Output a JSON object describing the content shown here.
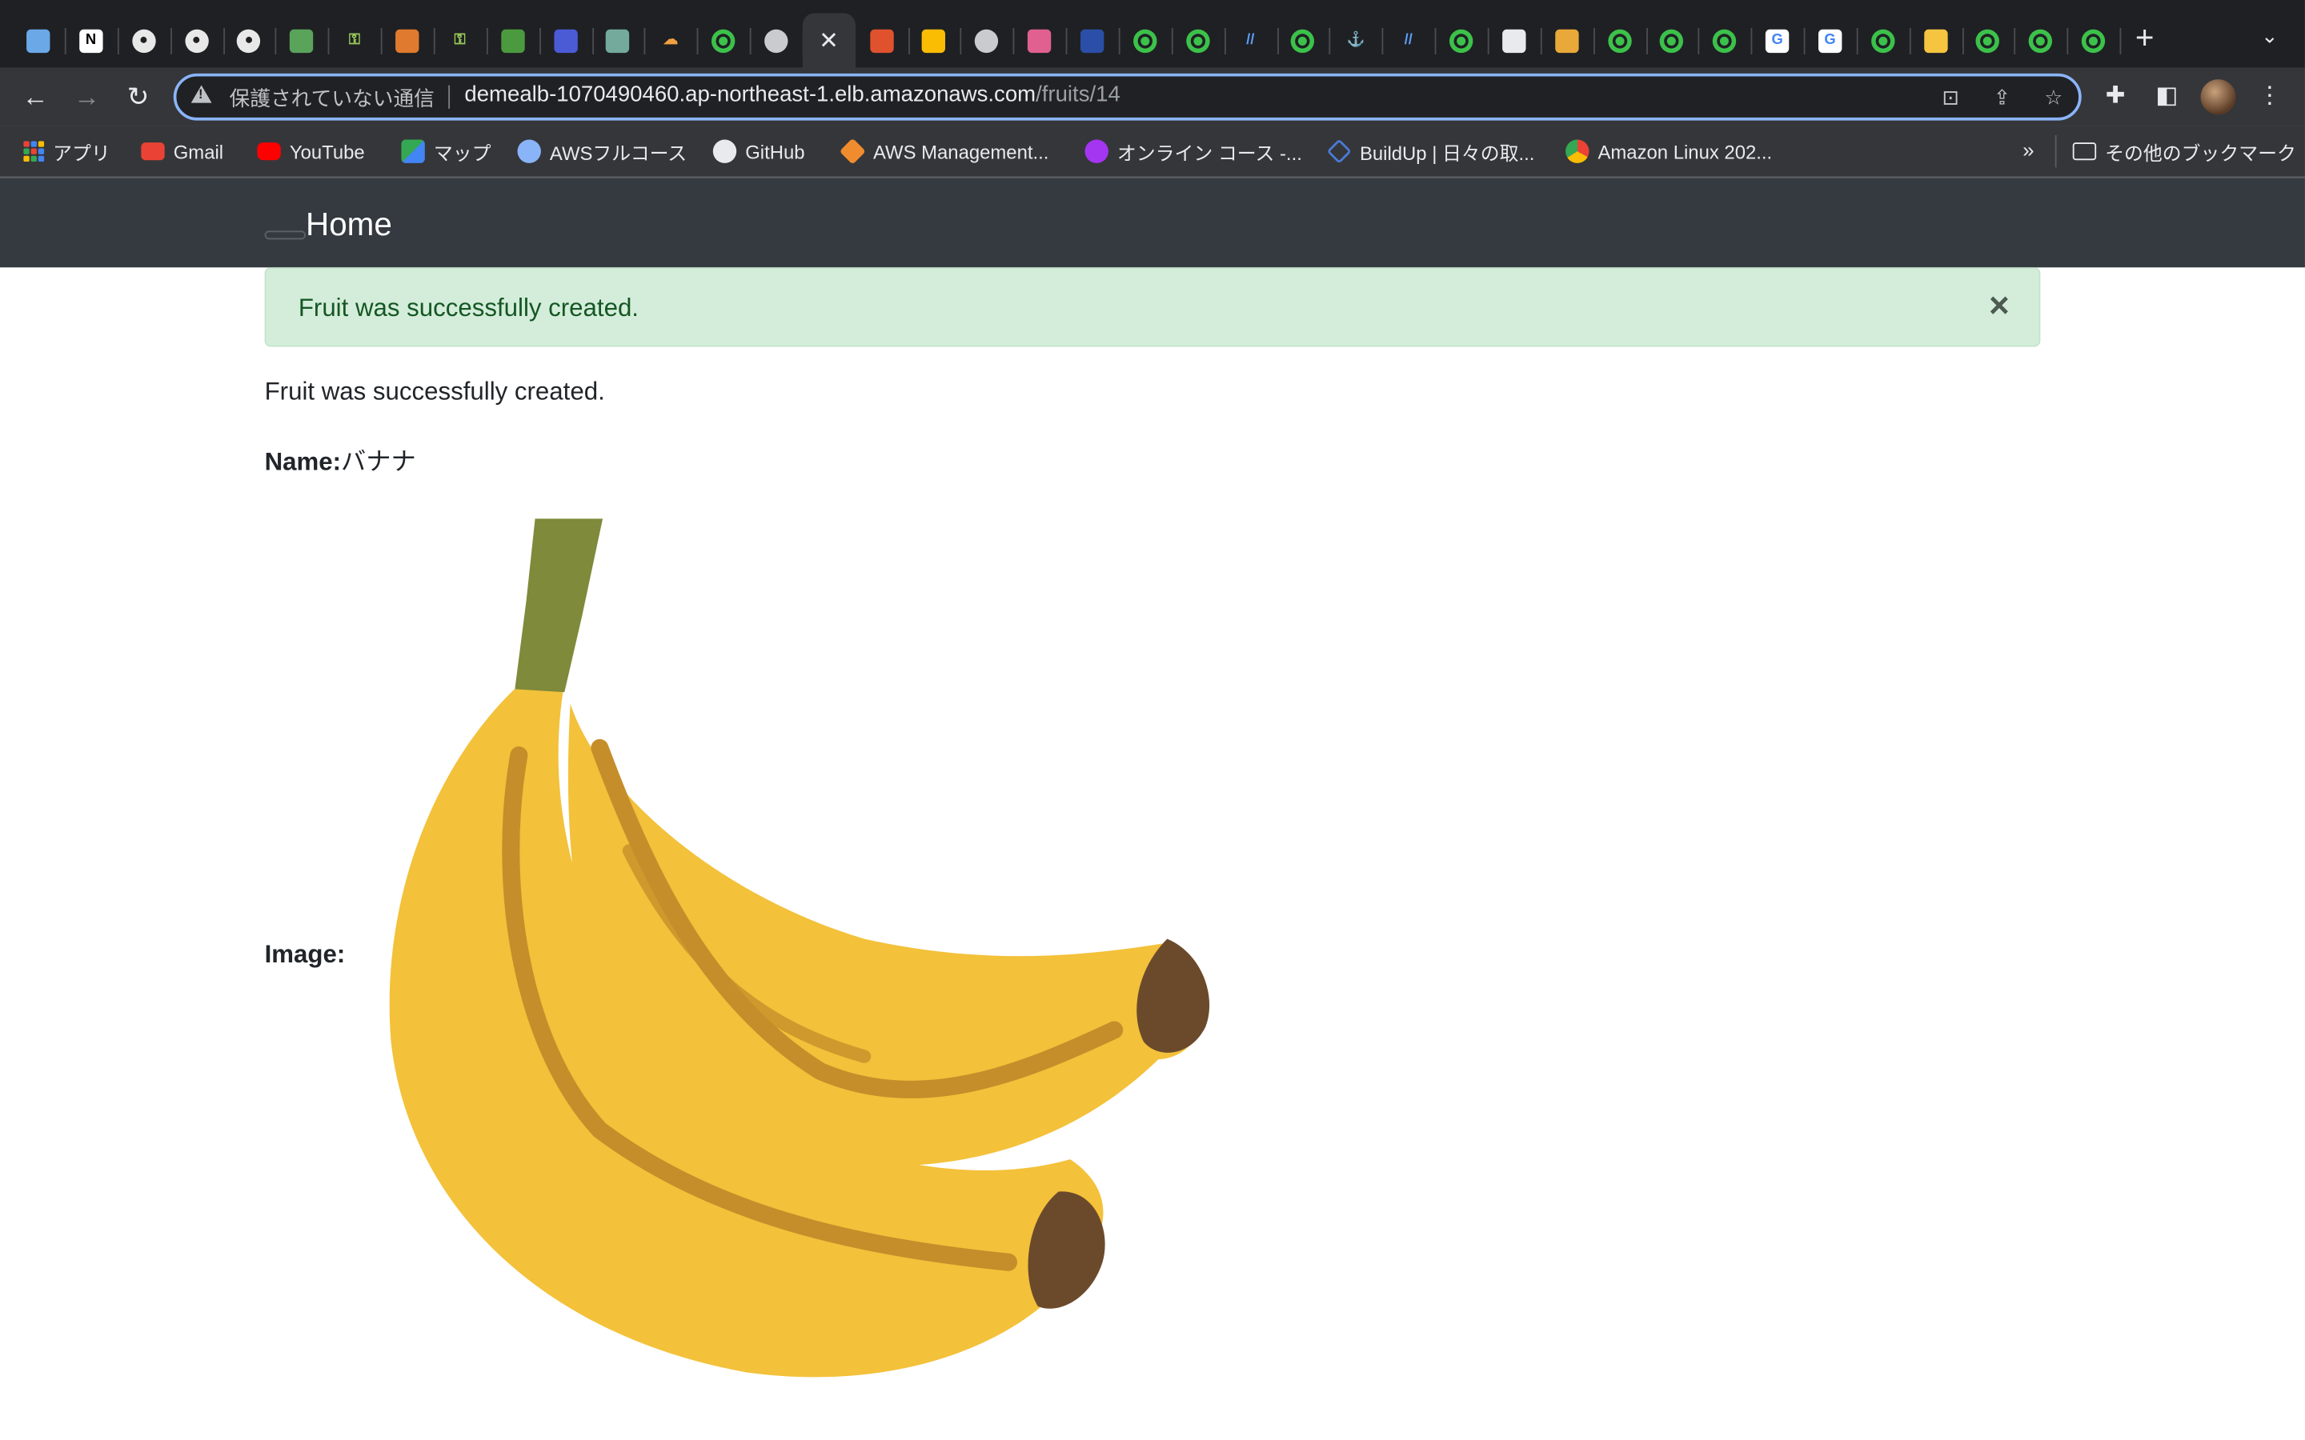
{
  "browser": {
    "tabs": [
      {
        "icon": "colorful-figure-icon"
      },
      {
        "icon": "notion-icon"
      },
      {
        "icon": "github-icon"
      },
      {
        "icon": "github-icon"
      },
      {
        "icon": "github-icon"
      },
      {
        "icon": "green-app-icon"
      },
      {
        "icon": "key-icon"
      },
      {
        "icon": "orange-app-icon"
      },
      {
        "icon": "key-icon"
      },
      {
        "icon": "green-square-icon"
      },
      {
        "icon": "blue-grid-icon"
      },
      {
        "icon": "chatgpt-icon"
      },
      {
        "icon": "cloud-outline-icon"
      },
      {
        "icon": "green-ring-icon"
      },
      {
        "icon": "globe-icon"
      },
      {
        "icon": "close-icon",
        "active": true
      },
      {
        "icon": "stackoverflow-icon"
      },
      {
        "icon": "chrome-icon"
      },
      {
        "icon": "globe-icon"
      },
      {
        "icon": "trello-icon"
      },
      {
        "icon": "buildup-icon"
      },
      {
        "icon": "green-ring-icon"
      },
      {
        "icon": "green-ring-icon"
      },
      {
        "icon": "slash-icon"
      },
      {
        "icon": "green-ring-icon"
      },
      {
        "icon": "anchor-icon"
      },
      {
        "icon": "slash-icon"
      },
      {
        "icon": "green-ring-icon"
      },
      {
        "icon": "document-icon"
      },
      {
        "icon": "box-icon"
      },
      {
        "icon": "green-ring-icon"
      },
      {
        "icon": "green-ring-icon"
      },
      {
        "icon": "green-ring-icon"
      },
      {
        "icon": "google-icon"
      },
      {
        "icon": "google-icon"
      },
      {
        "icon": "green-ring-icon"
      },
      {
        "icon": "emoji-icon"
      },
      {
        "icon": "green-ring-icon"
      },
      {
        "icon": "green-ring-icon"
      },
      {
        "icon": "green-ring-icon"
      }
    ],
    "security_label": "保護されていない通信",
    "url_host": "demealb-1070490460.ap-northeast-1.elb.amazonaws.com",
    "url_path": "/fruits/14",
    "bookmarks": [
      {
        "label": "アプリ",
        "icon": "apps-grid-icon"
      },
      {
        "label": "Gmail",
        "icon": "gmail-icon",
        "color": "#ea4335"
      },
      {
        "label": "YouTube",
        "icon": "youtube-icon",
        "color": "#ff0000"
      },
      {
        "label": "マップ",
        "icon": "maps-icon",
        "color": "#34a853"
      },
      {
        "label": "AWSフルコース",
        "icon": "aws-figure-icon",
        "color": "#8ab4f8"
      },
      {
        "label": "GitHub",
        "icon": "github-icon",
        "color": "#e8eaed"
      },
      {
        "label": "AWS Management...",
        "icon": "aws-cube-icon",
        "color": "#f08c2e"
      },
      {
        "label": "オンライン コース -...",
        "icon": "udemy-icon",
        "color": "#a435f0"
      },
      {
        "label": "BuildUp | 日々の取...",
        "icon": "buildup-icon",
        "color": "#4a7bd6"
      },
      {
        "label": "Amazon Linux 202...",
        "icon": "chrome-icon",
        "color": "#fbbc04"
      }
    ],
    "bookmarks_overflow": "»",
    "other_bookmarks": "その他のブックマーク"
  },
  "app": {
    "brand": "Home",
    "flash": "Fruit was successfully created.",
    "flash_close": "×",
    "notice": "Fruit was successfully created.",
    "name_label": "Name:",
    "name_value": "バナナ",
    "image_label": "Image:",
    "image_alt": "banana-illustration"
  },
  "colors": {
    "navbar": "#343a40",
    "alert_bg": "#d4edda",
    "alert_text": "#155724",
    "banana": "#f3c13a",
    "banana_stripe": "#c58e2a",
    "banana_tip": "#6b4a2c",
    "stem": "#7f8a3a"
  }
}
